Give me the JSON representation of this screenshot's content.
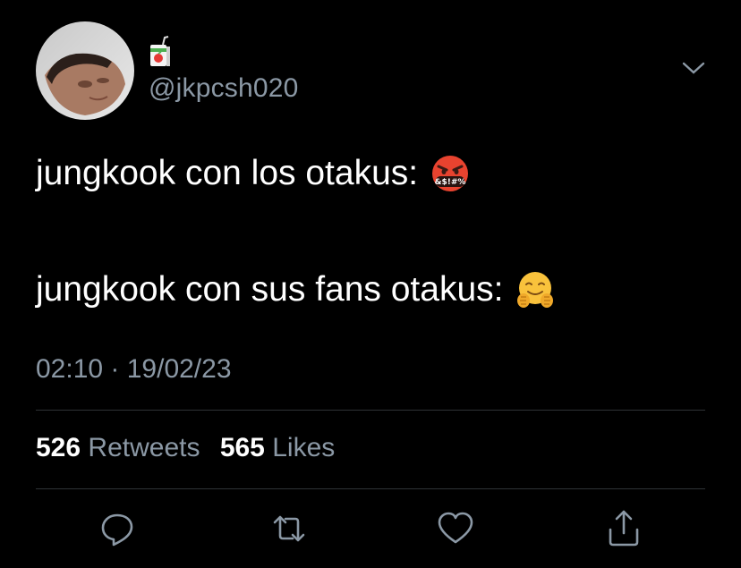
{
  "user": {
    "display_name_icon": "juice-box-icon",
    "handle": "@jkpcsh020",
    "avatar": "avatar-photo"
  },
  "tweet": {
    "line1": "jungkook con los otakus:",
    "line1_emoji": "face-with-symbols-on-mouth-emoji",
    "line1_emoji_text": "&$!#%",
    "line2": "jungkook con sus fans otakus:",
    "line2_emoji": "hugging-face-emoji",
    "timestamp": "02:10 · 19/02/23"
  },
  "stats": {
    "retweets_count": "526",
    "retweets_label": "Retweets",
    "likes_count": "565",
    "likes_label": "Likes"
  },
  "actions": [
    "reply-icon",
    "retweet-icon",
    "like-icon",
    "share-icon"
  ],
  "colors": {
    "background": "#000000",
    "text": "#ffffff",
    "secondary": "#8b98a5",
    "divider": "#2f3336"
  }
}
